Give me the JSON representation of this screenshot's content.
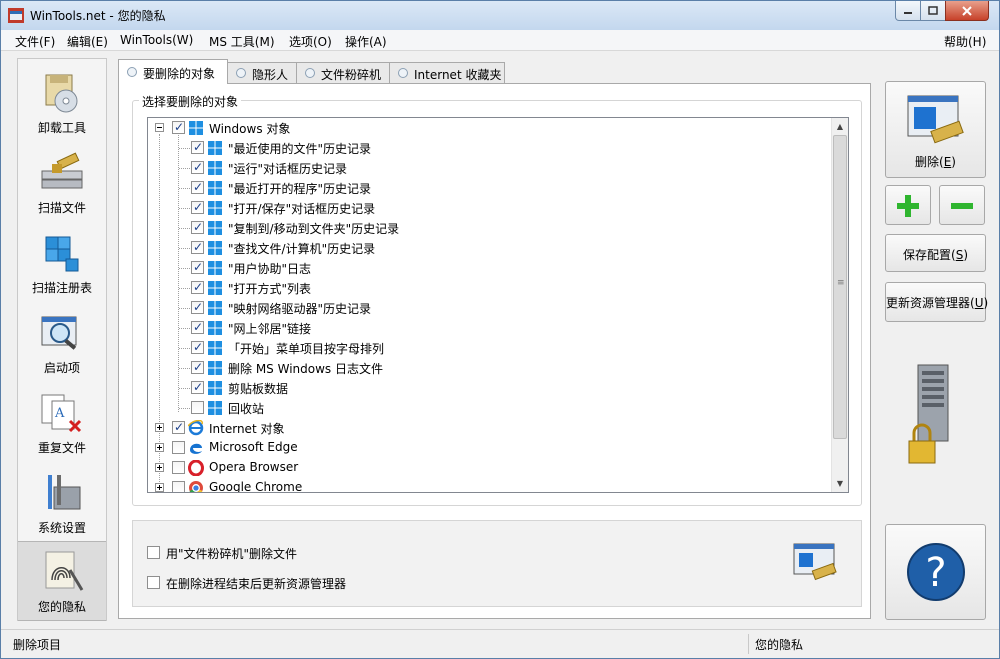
{
  "window": {
    "title": "WinTools.net - 您的隐私"
  },
  "menu": {
    "items": [
      "文件(F)",
      "编辑(E)",
      "WinTools(W)",
      "MS 工具(M)",
      "选项(O)",
      "操作(A)"
    ],
    "help": "帮助(H)"
  },
  "sidebar": {
    "items": [
      {
        "label": "卸载工具",
        "icon": "uninstall-cd-icon"
      },
      {
        "label": "扫描文件",
        "icon": "scan-files-icon"
      },
      {
        "label": "扫描注册表",
        "icon": "registry-cubes-icon"
      },
      {
        "label": "启动项",
        "icon": "startup-magnifier-icon"
      },
      {
        "label": "重复文件",
        "icon": "duplicate-files-icon"
      },
      {
        "label": "系统设置",
        "icon": "system-tools-icon"
      },
      {
        "label": "您的隐私",
        "icon": "fingerprint-icon"
      }
    ],
    "active_index": 6
  },
  "tabs": [
    {
      "label": "要删除的对象"
    },
    {
      "label": "隐形人"
    },
    {
      "label": "文件粉碎机"
    },
    {
      "label": "Internet 收藏夹"
    }
  ],
  "group_title": "选择要删除的对象",
  "tree": {
    "root": {
      "label": "Windows 对象",
      "checked": true,
      "expanded": true
    },
    "children": [
      {
        "label": "\"最近使用的文件\"历史记录",
        "checked": true
      },
      {
        "label": "\"运行\"对话框历史记录",
        "checked": true
      },
      {
        "label": "\"最近打开的程序\"历史记录",
        "checked": true
      },
      {
        "label": "\"打开/保存\"对话框历史记录",
        "checked": true
      },
      {
        "label": "\"复制到/移动到文件夹\"历史记录",
        "checked": true
      },
      {
        "label": "\"查找文件/计算机\"历史记录",
        "checked": true
      },
      {
        "label": "\"用户协助\"日志",
        "checked": true
      },
      {
        "label": "\"打开方式\"列表",
        "checked": true
      },
      {
        "label": "\"映射网络驱动器\"历史记录",
        "checked": true
      },
      {
        "label": "\"网上邻居\"链接",
        "checked": true
      },
      {
        "label": "「开始」菜单项目按字母排列",
        "checked": true
      },
      {
        "label": "删除 MS Windows 日志文件",
        "checked": true
      },
      {
        "label": "剪贴板数据",
        "checked": true
      },
      {
        "label": "回收站",
        "checked": false
      }
    ],
    "others": [
      {
        "label": "Internet 对象",
        "checked": true,
        "icon": "ie-icon"
      },
      {
        "label": "Microsoft Edge",
        "checked": false,
        "icon": "edge-icon"
      },
      {
        "label": "Opera Browser",
        "checked": false,
        "icon": "opera-icon"
      },
      {
        "label": "Google Chrome",
        "checked": false,
        "icon": "chrome-icon"
      }
    ]
  },
  "options": [
    {
      "label": "用\"文件粉碎机\"删除文件",
      "checked": false
    },
    {
      "label": "在删除进程结束后更新资源管理器",
      "checked": false
    }
  ],
  "right": {
    "delete_label": "删除(",
    "delete_key": "E",
    "save_config_label": "保存配置(",
    "save_config_key": "S",
    "refresh_label": "更新资源管理器(",
    "refresh_key": "U",
    "close_paren": ")"
  },
  "status": {
    "left": "删除项目",
    "right": "您的隐私"
  },
  "colors": {
    "accent": "#1f5fa8",
    "win_blue": "#1e8fe1",
    "plus_green": "#2fb52f"
  }
}
